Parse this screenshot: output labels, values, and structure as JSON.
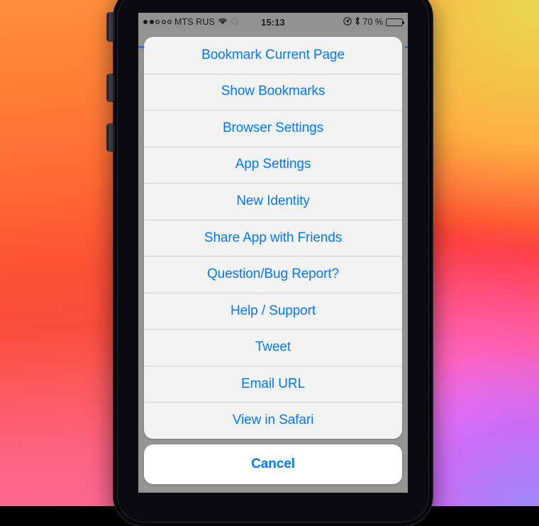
{
  "status_bar": {
    "signal_dots_filled": 2,
    "signal_dots_total": 5,
    "carrier": "MTS RUS",
    "wifi_icon": "wifi-icon",
    "activity_icon": "spinner-icon",
    "clock": "15:13",
    "location_icon": "location-arrow-icon",
    "bluetooth_icon": "bluetooth-icon",
    "battery_percent_label": "70 %",
    "battery_level": 70
  },
  "action_sheet": {
    "items": [
      {
        "label": "Bookmark Current Page"
      },
      {
        "label": "Show Bookmarks"
      },
      {
        "label": "Browser Settings"
      },
      {
        "label": "App Settings"
      },
      {
        "label": "New Identity"
      },
      {
        "label": "Share App with Friends"
      },
      {
        "label": "Question/Bug Report?"
      },
      {
        "label": "Help / Support"
      },
      {
        "label": "Tweet"
      },
      {
        "label": "Email URL"
      },
      {
        "label": "View in Safari"
      }
    ],
    "cancel_label": "Cancel"
  },
  "colors": {
    "accent_blue": "#007AFF",
    "sheet_background": "#F9F9F9",
    "cancel_background": "#FFFFFF",
    "backdrop_gray": "#9E9E9E",
    "progress_blue": "#1F6FE0"
  }
}
